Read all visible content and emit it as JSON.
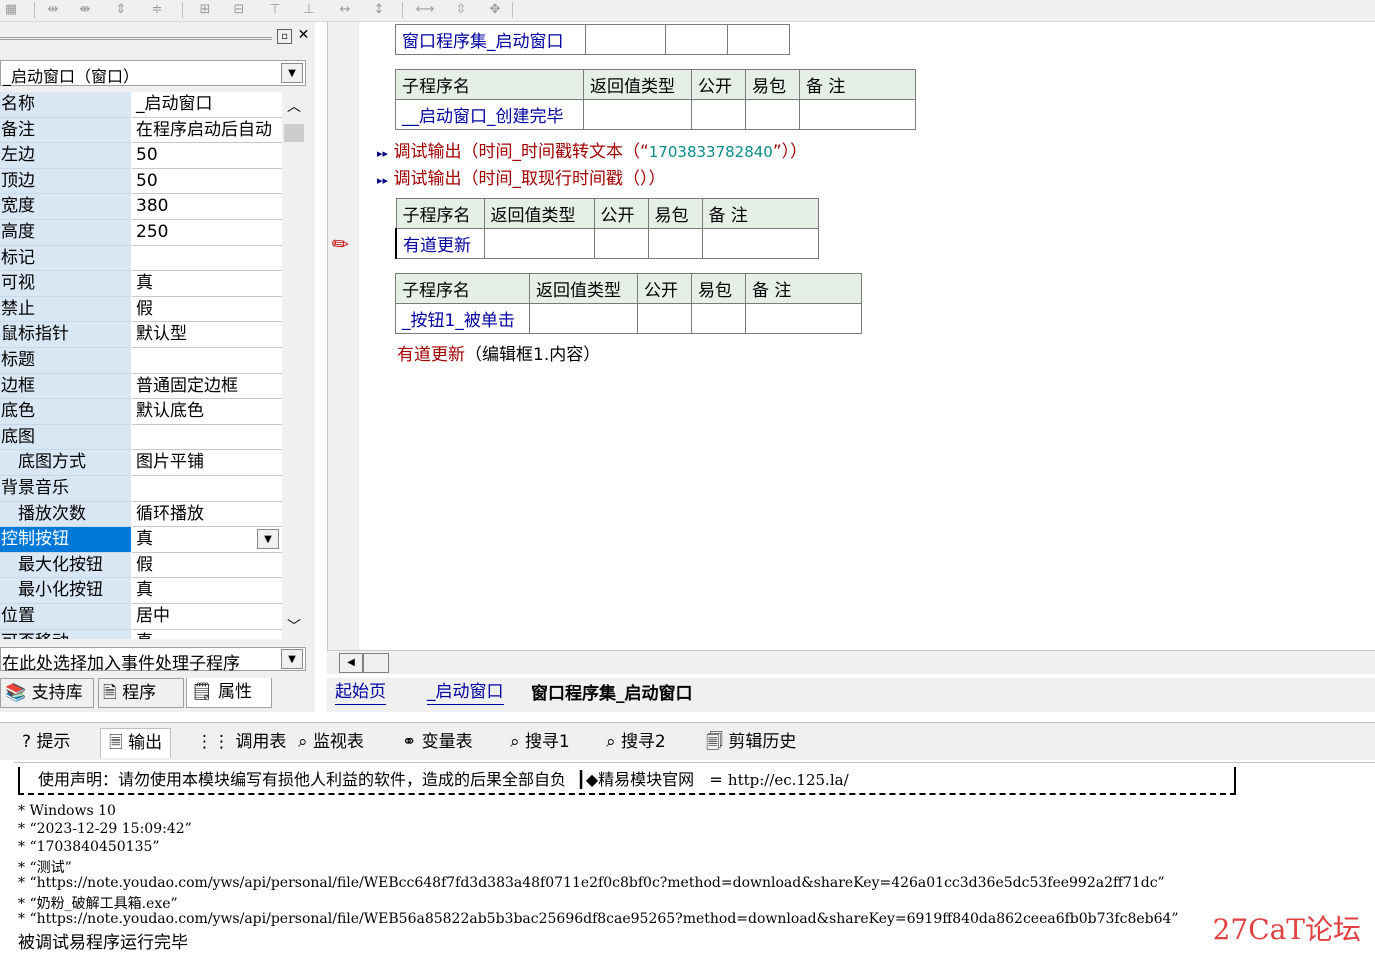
{
  "left_panel": {
    "object_selector": "_启动窗口（窗口）",
    "properties": [
      {
        "name": "名称",
        "value": "_启动窗口"
      },
      {
        "name": "备注",
        "value": "在程序启动后自动"
      },
      {
        "name": "左边",
        "value": "50"
      },
      {
        "name": "顶边",
        "value": "50"
      },
      {
        "name": "宽度",
        "value": "380"
      },
      {
        "name": "高度",
        "value": "250"
      },
      {
        "name": "标记",
        "value": ""
      },
      {
        "name": "可视",
        "value": "真"
      },
      {
        "name": "禁止",
        "value": "假"
      },
      {
        "name": "鼠标指针",
        "value": "默认型"
      },
      {
        "name": "标题",
        "value": ""
      },
      {
        "name": "边框",
        "value": "普通固定边框"
      },
      {
        "name": "底色",
        "value": "默认底色"
      },
      {
        "name": "底图",
        "value": ""
      },
      {
        "name": "底图方式",
        "value": "图片平铺"
      },
      {
        "name": "背景音乐",
        "value": ""
      },
      {
        "name": "播放次数",
        "value": "循环播放"
      },
      {
        "name": "控制按钮",
        "value": "真"
      },
      {
        "name": "最大化按钮",
        "value": "假"
      },
      {
        "name": "最小化按钮",
        "value": "真"
      },
      {
        "name": "位置",
        "value": "居中"
      },
      {
        "name": "可否移动",
        "value": "真"
      }
    ],
    "event_selector": "在此处选择加入事件处理子程序",
    "tabs": [
      "支持库",
      "程序",
      "属性"
    ]
  },
  "editor": {
    "assembly_name": "窗口程序集_启动窗口",
    "table_headers": [
      "子程序名",
      "返回值类型",
      "公开",
      "易包",
      "备 注"
    ],
    "sub1_name": "__启动窗口_创建完毕",
    "line1_func": "调试输出",
    "line1_open": "（时间_时间戳转文本（“",
    "line1_str": "1703833782840",
    "line1_close": "”））",
    "line2_func": "调试输出",
    "line2_rest": "（时间_取现行时间戳（））",
    "sub2_name": "有道更新",
    "sub3_name": "_按钮1_被单击",
    "line3_func": "有道更新",
    "line3_rest": "（编辑框1.内容）",
    "tabs": [
      "起始页",
      "_启动窗口",
      "窗口程序集_启动窗口"
    ]
  },
  "bottom_tabs": [
    "提示",
    "输出",
    "调用表",
    "监视表",
    "变量表",
    "搜寻1",
    "搜寻2",
    "剪辑历史"
  ],
  "output": {
    "disclaimer": "使用声明：请勿使用本模块编写有损他人利益的软件，造成的后果全部自负",
    "site_label": "◆精易模块官网",
    "site_eq": "=",
    "site_url": "http://ec.125.la/",
    "lines": [
      "* Windows 10",
      "* “2023-12-29 15:09:42”",
      "* “1703840450135”",
      "* “测试”",
      "* “https://note.youdao.com/yws/api/personal/file/WEBcc648f7fd3d383a48f0711e2f0c8bf0c?method=download&shareKey=426a01cc3d36e5dc53fee992a2ff71dc”",
      "* “奶粉_破解工具箱.exe”",
      "* “https://note.youdao.com/yws/api/personal/file/WEB56a85822ab5b3bac25696df8cae95265?method=download&shareKey=6919ff840da862ceea6fb0b73fc8eb64”"
    ],
    "final": "被调试易程序运行完毕"
  },
  "watermark": "27CaT论坛"
}
